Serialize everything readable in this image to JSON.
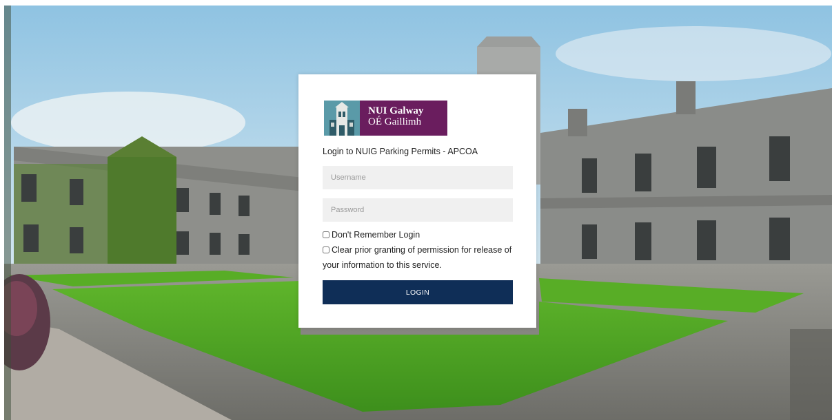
{
  "logo": {
    "line1": "NUI Galway",
    "line2": "OÉ Gaillimh",
    "brand_color": "#6a1d5e",
    "emblem_color": "#4b8a9a"
  },
  "login": {
    "subtitle": "Login to NUIG Parking Permits - APCOA",
    "username_placeholder": "Username",
    "password_placeholder": "Password",
    "remember_label": "Don't Remember Login",
    "clear_permission_label": "Clear prior granting of permission for release of your information to this service.",
    "button_label": "LOGIN",
    "button_color": "#0f2e57"
  }
}
